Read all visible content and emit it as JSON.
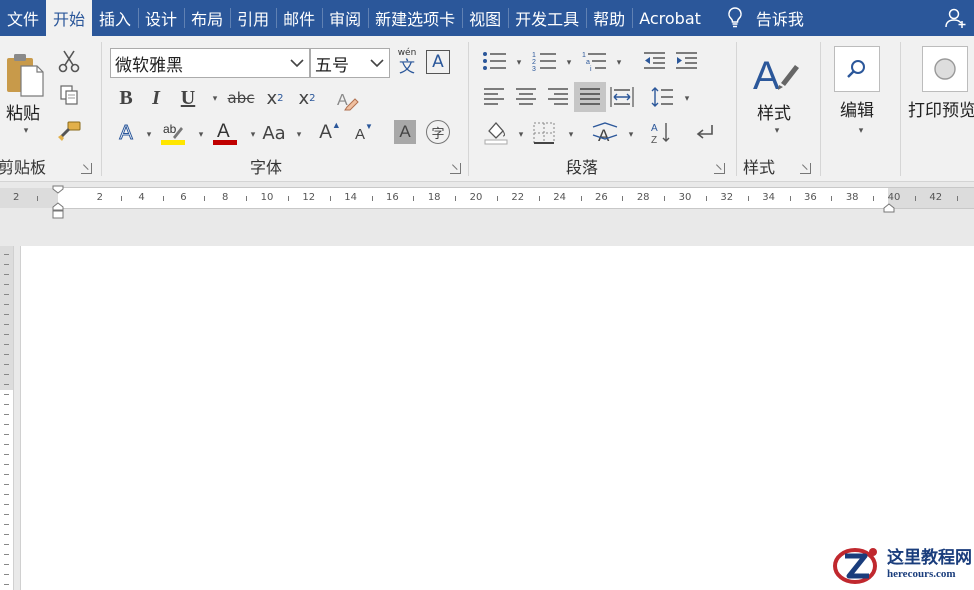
{
  "tabs": [
    "文件",
    "开始",
    "插入",
    "设计",
    "布局",
    "引用",
    "邮件",
    "审阅",
    "新建选项卡",
    "视图",
    "开发工具",
    "帮助",
    "Acrobat"
  ],
  "active_tab": "开始",
  "tell_me": "告诉我",
  "clipboard": {
    "paste_label": "粘贴",
    "group_label": "剪贴板"
  },
  "font": {
    "name": "微软雅黑",
    "size": "五号",
    "group_label": "字体",
    "bold": "B",
    "italic": "I",
    "underline": "U",
    "strike": "abc",
    "subscript": "x",
    "subscript_mark": "2",
    "superscript": "x",
    "superscript_mark": "2",
    "change_case": "Aa",
    "grow": "A",
    "shrink": "A",
    "phonetic_top": "wén",
    "phonetic_char": "文",
    "enclose_char": "字"
  },
  "paragraph": {
    "group_label": "段落"
  },
  "styles": {
    "button_label": "样式",
    "group_label": "样式"
  },
  "editing": {
    "button_label": "编辑"
  },
  "print_preview": {
    "button_label": "打印预览"
  },
  "ruler": {
    "labels": [
      "2",
      "2",
      "4",
      "6",
      "8",
      "10",
      "12",
      "14",
      "16",
      "18",
      "20",
      "22",
      "24",
      "26",
      "28",
      "30",
      "32",
      "34",
      "36",
      "38",
      "40",
      "42"
    ]
  },
  "watermark": {
    "title": "这里教程网",
    "url": "herecours.com"
  },
  "colors": {
    "accent": "#2b579a",
    "highlight": "#ffe600",
    "font_color": "#c00000"
  }
}
